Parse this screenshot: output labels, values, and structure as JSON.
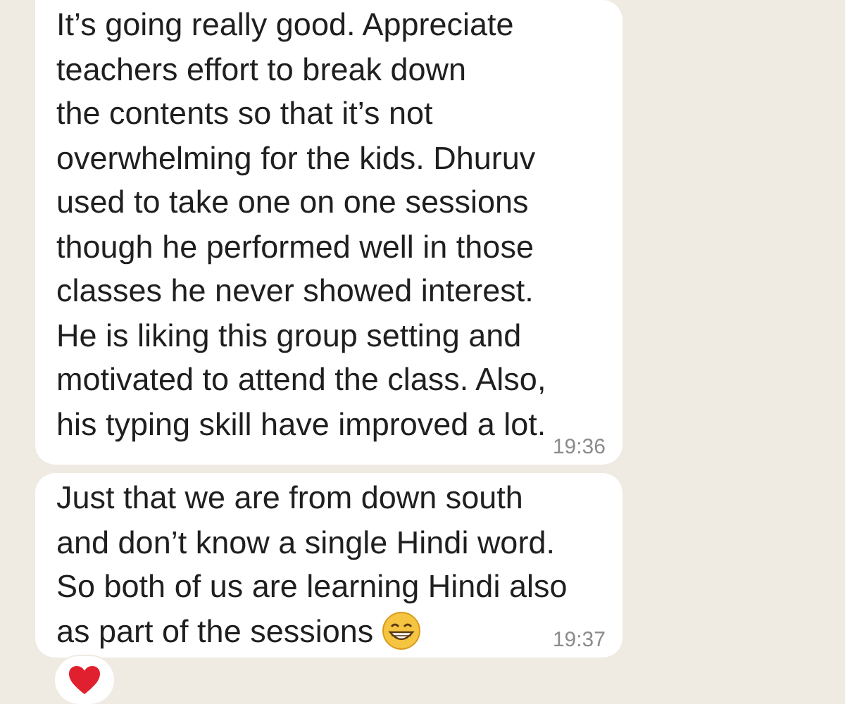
{
  "messages": [
    {
      "lines": [
        "It’s going really good. Appreciate",
        "teachers effort to break down",
        "the contents so that it’s not",
        "overwhelming for the kids. Dhuruv",
        "used to take one on one sessions",
        "though he performed well in those",
        "classes he never showed interest.",
        "He is liking this group setting and",
        "motivated to attend the class. Also,",
        "his typing skill have improved a lot."
      ],
      "time": "19:36"
    },
    {
      "lines": [
        "Just that we are from down south",
        "and don’t know a single Hindi word.",
        "So both of us are learning Hindi also",
        "as part of the sessions"
      ],
      "emoji": {
        "kind": "grin"
      },
      "time": "19:37",
      "reaction": {
        "kind": "heart"
      }
    }
  ]
}
